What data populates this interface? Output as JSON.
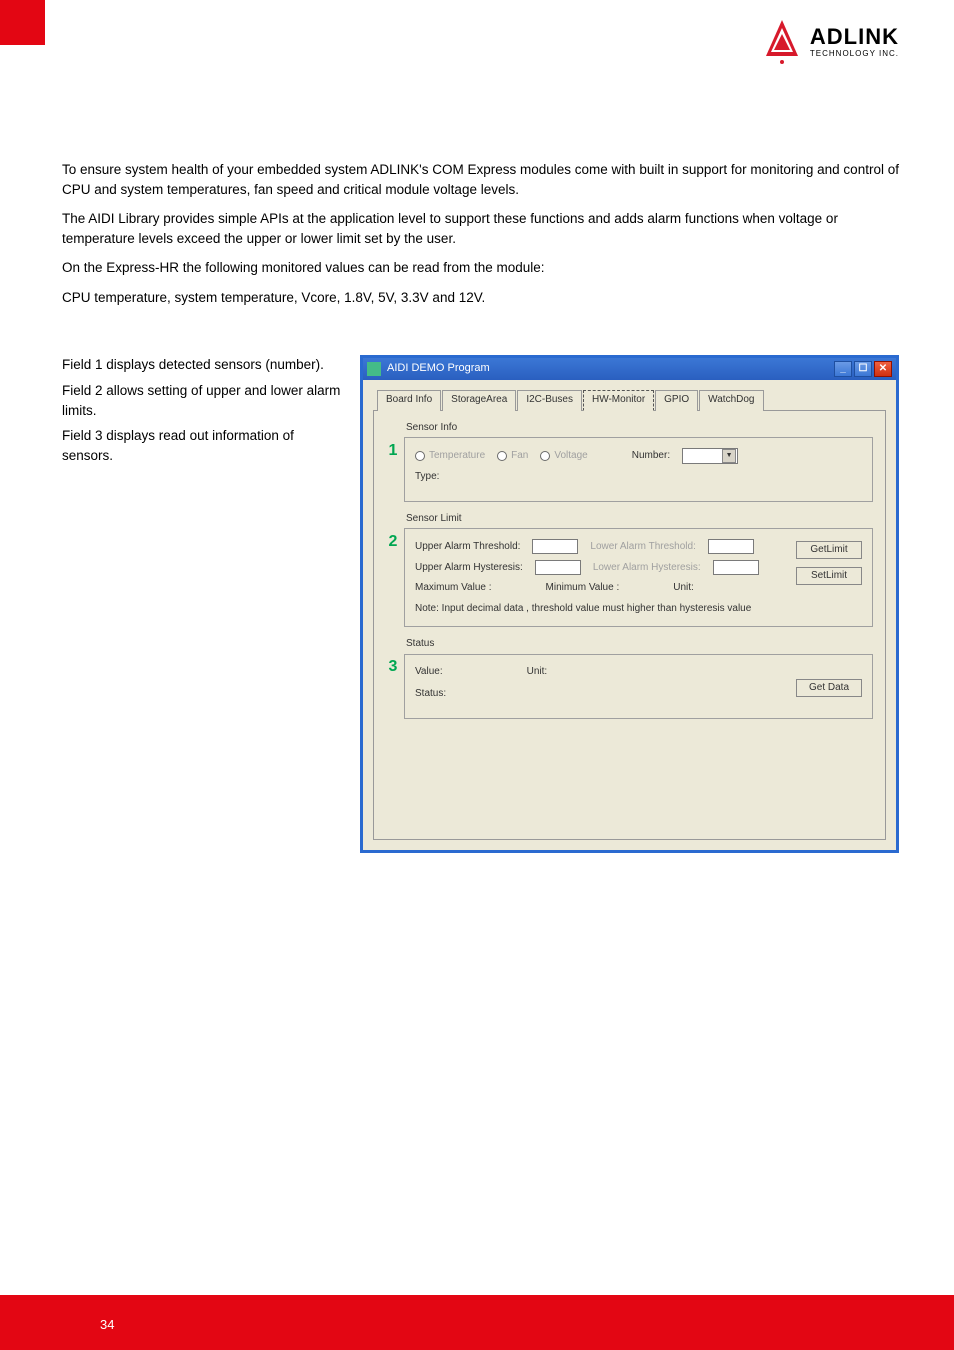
{
  "logo": {
    "line1": "ADLINK",
    "line2": "TECHNOLOGY INC."
  },
  "body": {
    "p1": "To ensure system health of your embedded system ADLINK's COM Express modules come with built in support for monitoring and control of CPU and system temperatures, fan speed and critical module voltage levels.",
    "p2": "The AIDI Library provides simple APIs at the application level to support these functions and adds alarm functions when voltage or temperature levels exceed the upper or lower limit set by the user.",
    "p3": "On the Express-HR the following monitored values can be read from the module:",
    "p4": "CPU temperature, system temperature, Vcore, 1.8V, 5V, 3.3V and 12V."
  },
  "left": {
    "l1": "Field 1 displays detected sensors (number).",
    "l2": "Field 2 allows setting of upper and lower alarm limits.",
    "l3": "Field 3 displays read out information of sensors."
  },
  "win": {
    "title": "AIDI DEMO Program",
    "tabs": [
      "Board Info",
      "StorageArea",
      "I2C-Buses",
      "HW-Monitor",
      "GPIO",
      "WatchDog"
    ],
    "active_tab_index": 3,
    "nums": {
      "n1": "1",
      "n2": "2",
      "n3": "3"
    },
    "group1": {
      "title": "Sensor Info",
      "radio_temp": "Temperature",
      "radio_fan": "Fan",
      "radio_volt": "Voltage",
      "number_label": "Number:",
      "type_label": "Type:"
    },
    "group2": {
      "title": "Sensor Limit",
      "uat": "Upper Alarm Threshold:",
      "lat": "Lower Alarm Threshold:",
      "uah": "Upper Alarm Hysteresis:",
      "lah": "Lower Alarm Hysteresis:",
      "max": "Maximum Value :",
      "min": "Minimum Value :",
      "unit": "Unit:",
      "note": "Note: Input decimal data , threshold  value must  higher than hysteresis value",
      "btn_get": "GetLimit",
      "btn_set": "SetLimit"
    },
    "group3": {
      "title": "Status",
      "value": "Value:",
      "unit": "Unit:",
      "status": "Status:",
      "btn_get": "Get Data"
    }
  },
  "page_number": "34"
}
